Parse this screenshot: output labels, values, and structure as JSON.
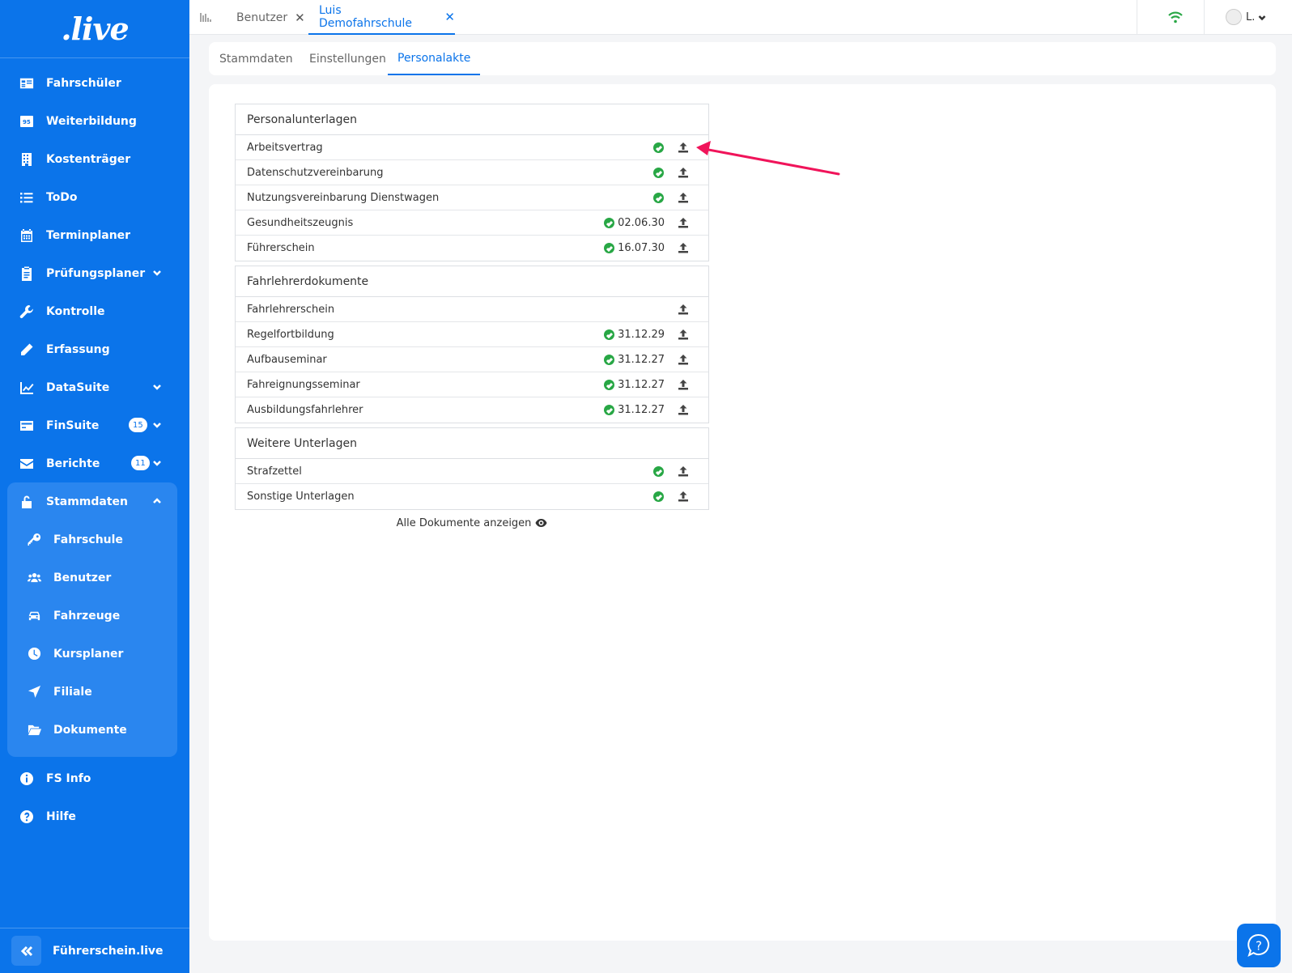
{
  "brand": {
    "logo_text": ".live",
    "accent": "#0b74ea"
  },
  "sidebar": {
    "items": [
      {
        "label": "Fahrschüler",
        "icon": "id-card-icon"
      },
      {
        "label": "Weiterbildung",
        "icon": "badge-95-icon"
      },
      {
        "label": "Kostenträger",
        "icon": "building-icon"
      },
      {
        "label": "ToDo",
        "icon": "list-icon"
      },
      {
        "label": "Terminplaner",
        "icon": "calendar-icon"
      },
      {
        "label": "Prüfungsplaner",
        "icon": "clipboard-icon"
      },
      {
        "label": "Kontrolle",
        "icon": "wrench-icon"
      },
      {
        "label": "Erfassung",
        "icon": "pencil-icon"
      },
      {
        "label": "DataSuite",
        "icon": "line-chart-icon"
      },
      {
        "label": "FinSuite",
        "icon": "credit-card-icon",
        "badge": "15"
      },
      {
        "label": "Berichte",
        "icon": "envelope-icon",
        "badge": "11"
      }
    ],
    "group": {
      "label": "Stammdaten",
      "icon": "unlock-icon",
      "children": [
        {
          "label": "Fahrschule",
          "icon": "key-icon"
        },
        {
          "label": "Benutzer",
          "icon": "users-icon"
        },
        {
          "label": "Fahrzeuge",
          "icon": "car-icon"
        },
        {
          "label": "Kursplaner",
          "icon": "clock-icon"
        },
        {
          "label": "Filiale",
          "icon": "location-arrow-icon"
        },
        {
          "label": "Dokumente",
          "icon": "folder-open-icon"
        }
      ]
    },
    "bottom_items": [
      {
        "label": "FS Info",
        "icon": "info-icon"
      },
      {
        "label": "Hilfe",
        "icon": "question-icon"
      }
    ],
    "footer_label": "Führerschein.live"
  },
  "topbar": {
    "tabs": [
      {
        "label": "Benutzer",
        "close": "✕"
      },
      {
        "label": "Luis Demofahrschule",
        "close": "✕"
      }
    ],
    "user_initial": "L."
  },
  "subtabs": [
    "Stammdaten",
    "Einstellungen",
    "Personalakte"
  ],
  "sections": [
    {
      "title": "Personalunterlagen",
      "rows": [
        {
          "label": "Arbeitsvertrag",
          "ok": true,
          "date": ""
        },
        {
          "label": "Datenschutzvereinbarung",
          "ok": true,
          "date": ""
        },
        {
          "label": "Nutzungsvereinbarung Dienstwagen",
          "ok": true,
          "date": ""
        },
        {
          "label": "Gesundheitszeugnis",
          "ok": true,
          "date": "02.06.30"
        },
        {
          "label": "Führerschein",
          "ok": true,
          "date": "16.07.30"
        }
      ]
    },
    {
      "title": "Fahrlehrerdokumente",
      "rows": [
        {
          "label": "Fahrlehrerschein",
          "ok": false,
          "date": ""
        },
        {
          "label": "Regelfortbildung",
          "ok": true,
          "date": "31.12.29"
        },
        {
          "label": "Aufbauseminar",
          "ok": true,
          "date": "31.12.27"
        },
        {
          "label": "Fahreignungsseminar",
          "ok": true,
          "date": "31.12.27"
        },
        {
          "label": "Ausbildungsfahrlehrer",
          "ok": true,
          "date": "31.12.27"
        }
      ]
    },
    {
      "title": "Weitere Unterlagen",
      "rows": [
        {
          "label": "Strafzettel",
          "ok": true,
          "date": ""
        },
        {
          "label": "Sonstige Unterlagen",
          "ok": true,
          "date": ""
        }
      ]
    }
  ],
  "show_all_label": "Alle Dokumente anzeigen",
  "colors": {
    "ok": "#28a745",
    "annotation_arrow": "#f0145a",
    "wifi": "#28a745"
  }
}
